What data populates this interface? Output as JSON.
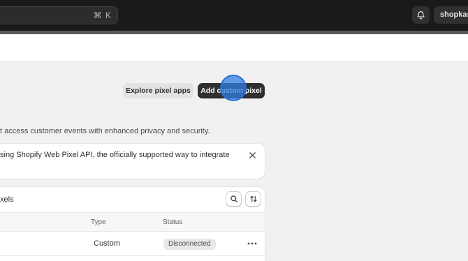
{
  "topbar": {
    "search_shortcut": "⌘ K",
    "store_name": "shopkasp",
    "bell_icon": "bell-icon"
  },
  "header": {
    "explore_button": "Explore pixel apps",
    "add_button": "Add custom pixel"
  },
  "description": "t access customer events with enhanced privacy and security.",
  "banner": {
    "text": "sing Shopify Web Pixel API, the officially supported way to integrate",
    "close_icon": "close-icon"
  },
  "pixels_card": {
    "title": "xels",
    "search_icon": "search-icon",
    "sort_icon": "sort-icon",
    "columns": [
      "Type",
      "Status"
    ],
    "rows": [
      {
        "type": "Custom",
        "status": "Disconnected"
      }
    ]
  },
  "colors": {
    "topbar": "#1a1a1a",
    "primary_button": "#303030",
    "cursor": "#2e7de2"
  }
}
